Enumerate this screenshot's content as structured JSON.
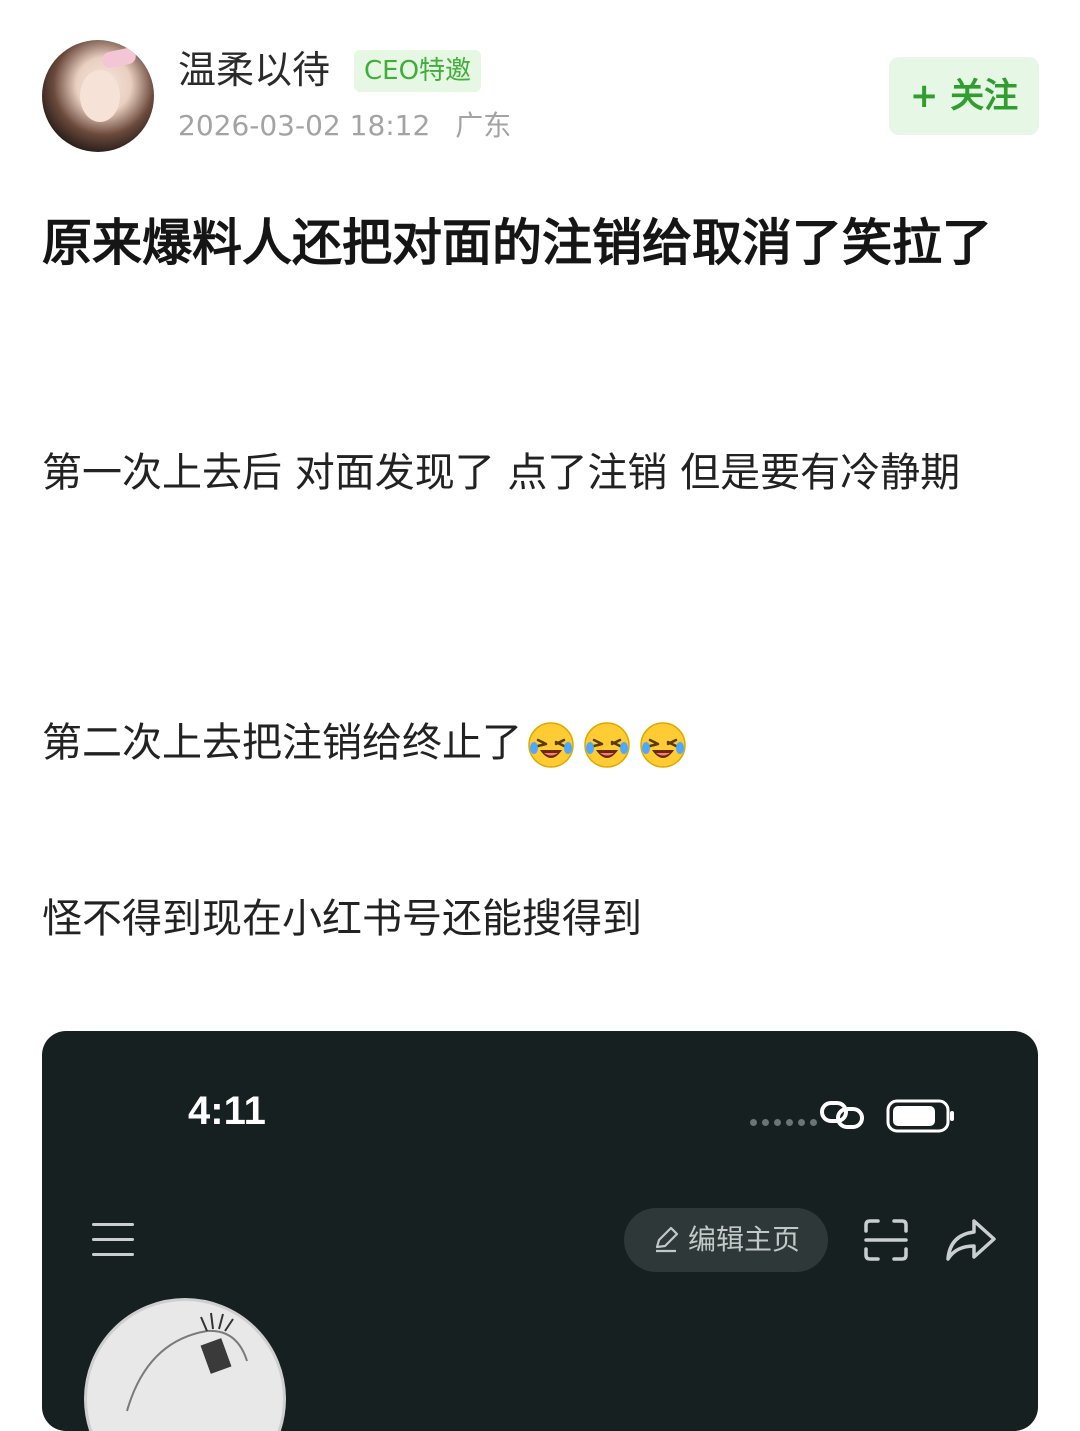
{
  "author": {
    "name": "温柔以待",
    "badge": "CEO特邀",
    "date": "2026-03-02 18:12",
    "location": "广东",
    "follow_label": "+ 关注"
  },
  "post": {
    "title": "原来爆料人还把对面的注销给取消了笑拉了",
    "paragraphs": [
      "第一次上去后 对面发现了 点了注销 但是要有冷静期",
      "第二次上去把注销给终止了",
      "怪不得到现在小红书号还能搜得到"
    ],
    "emojis": [
      "rofl-emoji",
      "rofl-emoji",
      "rofl-emoji"
    ]
  },
  "screenshot": {
    "time": "4:11",
    "edit_label": "编辑主页",
    "icons": [
      "menu-icon",
      "scan-icon",
      "share-icon",
      "link-icon",
      "battery-icon",
      "edit-pencil-icon"
    ]
  },
  "colors": {
    "accent_green": "#2f9e2e",
    "badge_bg": "#e6f7e3",
    "screenshot_bg": "#172020"
  }
}
